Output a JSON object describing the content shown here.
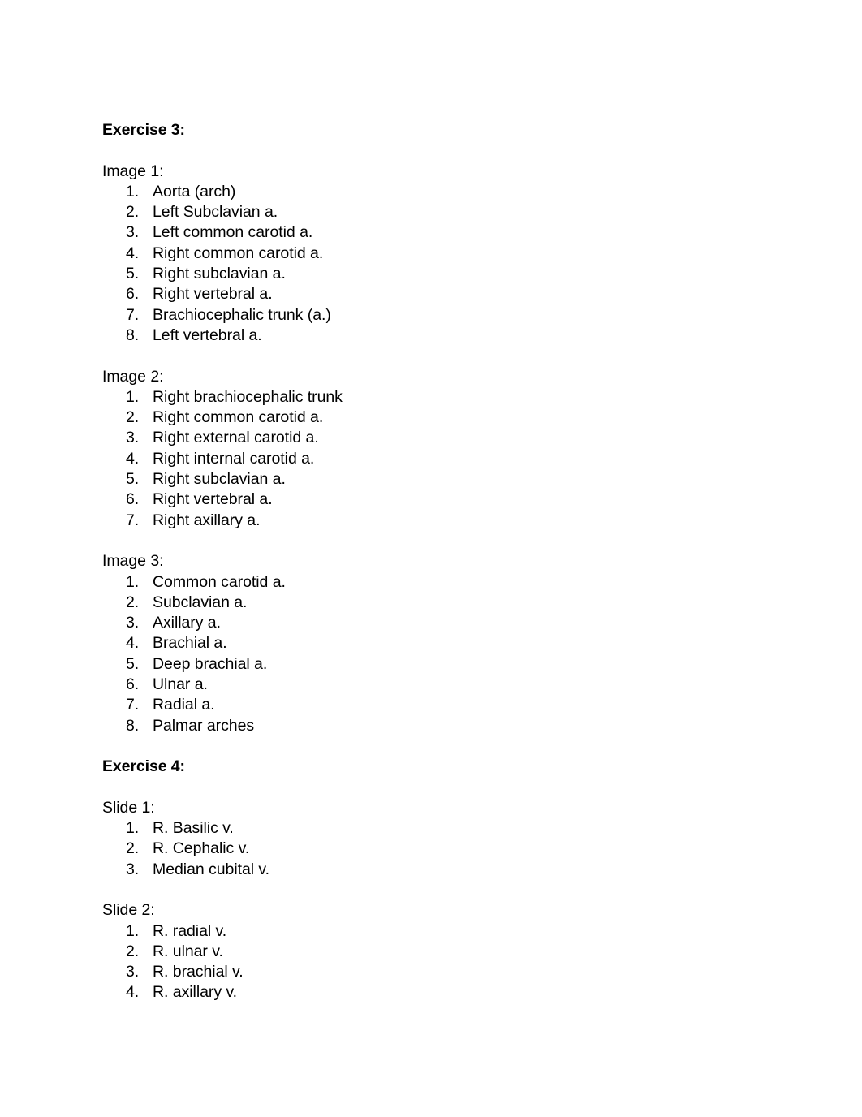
{
  "document": {
    "sections": [
      {
        "heading": "Exercise 3:",
        "groups": [
          {
            "label": "Image 1:",
            "items": [
              "Aorta (arch)",
              "Left Subclavian a.",
              "Left common carotid a.",
              "Right common carotid a.",
              "Right subclavian a.",
              "Right vertebral a.",
              "Brachiocephalic trunk (a.)",
              "Left vertebral a."
            ]
          },
          {
            "label": "Image 2:",
            "items": [
              "Right brachiocephalic trunk",
              "Right common carotid a.",
              "Right external carotid a.",
              "Right internal carotid a.",
              "Right subclavian a.",
              "Right vertebral a.",
              "Right axillary a."
            ]
          },
          {
            "label": "Image 3:",
            "items": [
              "Common carotid a.",
              "Subclavian a.",
              "Axillary a.",
              "Brachial a.",
              "Deep brachial a.",
              "Ulnar a.",
              "Radial a.",
              "Palmar arches"
            ]
          }
        ]
      },
      {
        "heading": "Exercise 4:",
        "groups": [
          {
            "label": "Slide 1:",
            "items": [
              "R. Basilic v.",
              "R. Cephalic v.",
              "Median cubital v."
            ]
          },
          {
            "label": "Slide 2:",
            "items": [
              "R. radial v.",
              "R. ulnar v.",
              "R. brachial v.",
              "R. axillary v."
            ]
          }
        ]
      }
    ]
  },
  "style": {
    "text_color": "#000000",
    "page_background": "#ffffff"
  }
}
